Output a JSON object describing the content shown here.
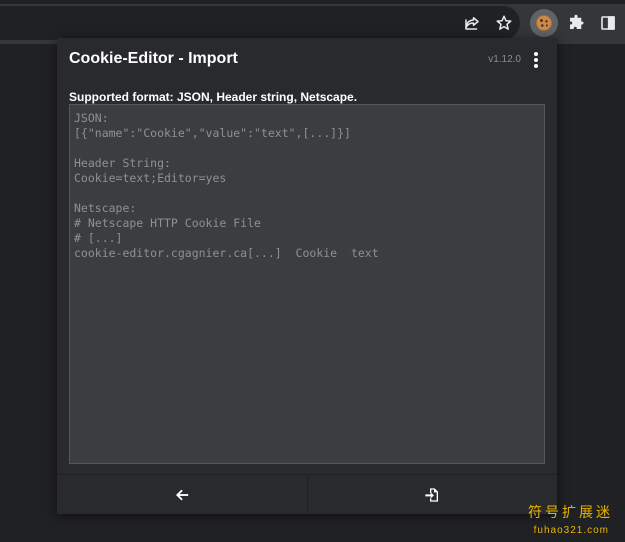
{
  "toolbar": {
    "icons": [
      "share-icon",
      "star-icon",
      "cookie-icon",
      "puzzle-icon",
      "side-panel-icon"
    ]
  },
  "popup": {
    "title": "Cookie-Editor - Import",
    "version": "v1.12.0",
    "format_label": "Supported format: JSON, Header string, Netscape.",
    "placeholder": "JSON:\n[{\"name\":\"Cookie\",\"value\":\"text\",[...]}]\n\nHeader String:\nCookie=text;Editor=yes\n\nNetscape:\n# Netscape HTTP Cookie File\n# [...]\ncookie-editor.cgagnier.ca[...]  Cookie  text",
    "value": ""
  },
  "footer": {
    "back_icon": "arrow-left-icon",
    "import_icon": "file-import-icon"
  },
  "watermark": {
    "text": "符号扩展迷",
    "domain": "fuhao321.com"
  }
}
